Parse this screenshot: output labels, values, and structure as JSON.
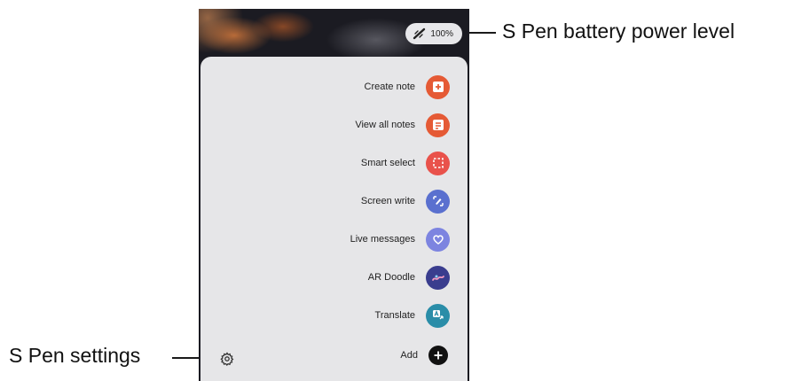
{
  "battery": {
    "level": "100%",
    "icon": "s-pen-icon"
  },
  "menu": {
    "items": [
      {
        "label": "Create note",
        "icon": "create-note-icon",
        "color": "#e55a35"
      },
      {
        "label": "View all notes",
        "icon": "view-all-notes-icon",
        "color": "#e55a35"
      },
      {
        "label": "Smart select",
        "icon": "smart-select-icon",
        "color": "#e9524b"
      },
      {
        "label": "Screen write",
        "icon": "screen-write-icon",
        "color": "#5a70cf"
      },
      {
        "label": "Live messages",
        "icon": "live-messages-icon",
        "color": "#7d84e0"
      },
      {
        "label": "AR Doodle",
        "icon": "ar-doodle-icon",
        "color": "#3a3d8e"
      },
      {
        "label": "Translate",
        "icon": "translate-icon",
        "color": "#2a8da8"
      },
      {
        "label": "Add",
        "icon": "add-icon",
        "color": "#111111"
      }
    ]
  },
  "settings": {
    "icon": "gear-icon"
  },
  "callouts": {
    "battery_label": "S Pen battery power level",
    "settings_label": "S Pen settings"
  }
}
